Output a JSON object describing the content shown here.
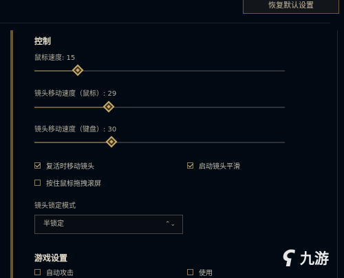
{
  "reset_button": "恢复默认设置",
  "control": {
    "title": "控制",
    "sliders": [
      {
        "label": "鼠标速度: 15",
        "level": 0.175
      },
      {
        "label": "镜头移动速度（鼠标）: 29",
        "level": 0.3
      },
      {
        "label": "镜头移动速度（键盘）: 30",
        "level": 0.31
      }
    ],
    "checkboxes": [
      {
        "label": "复活时移动镜头",
        "checked": true
      },
      {
        "label": "启动镜头平滑",
        "checked": true
      },
      {
        "label": "按住鼠标拖拽滚屏",
        "checked": false
      }
    ],
    "lock_mode_label": "镜头锁定模式",
    "lock_mode_value": "半锁定"
  },
  "game_settings": {
    "title": "游戏设置",
    "partial_items": [
      "自动攻击",
      "使用"
    ]
  },
  "logo": {
    "text": "九游"
  }
}
